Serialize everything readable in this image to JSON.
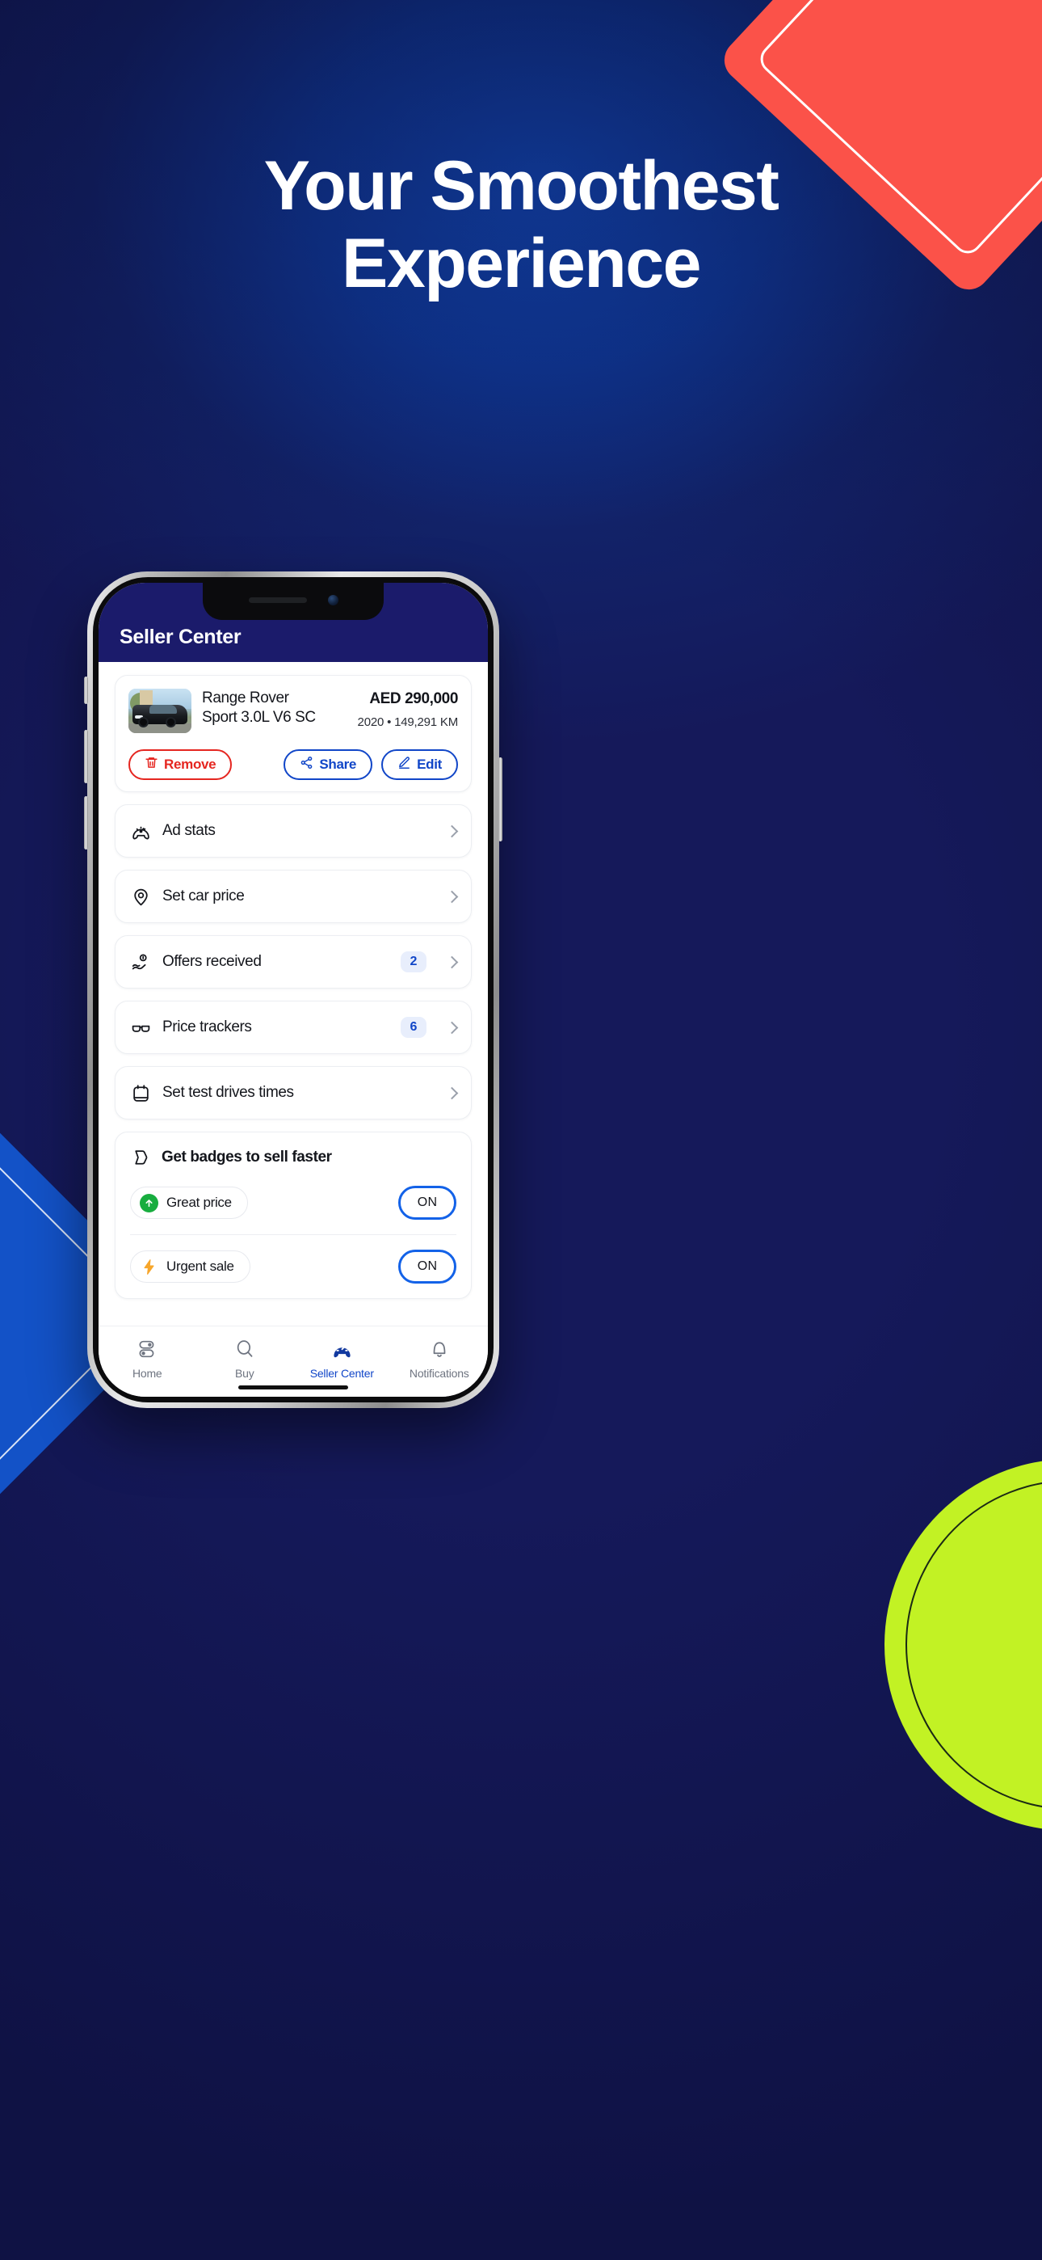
{
  "hero": {
    "headline_line1": "Your Smoothest",
    "headline_line2": "Experience"
  },
  "colors": {
    "brand_blue": "#1146c8",
    "header_navy": "#1b1b6b",
    "danger_red": "#e52620",
    "accent_red": "#fb5249",
    "accent_lime": "#c2f224",
    "badge_green": "#18ad3f",
    "badge_orange": "#f7a62b"
  },
  "app": {
    "header": {
      "title": "Seller Center"
    },
    "listing": {
      "title_line1": "Range Rover",
      "title_line2": "Sport 3.0L V6 SC",
      "price": "AED 290,000",
      "meta": "2020 • 149,291 KM",
      "thumb_icon": "car-photo",
      "actions": [
        {
          "label": "Remove",
          "icon": "trash-icon",
          "style": "red"
        },
        {
          "label": "Share",
          "icon": "share-icon",
          "style": "blue"
        },
        {
          "label": "Edit",
          "icon": "pencil-icon",
          "style": "blue"
        }
      ]
    },
    "menu": [
      {
        "label": "Ad stats",
        "icon": "gauge-icon",
        "badge": ""
      },
      {
        "label": "Set car price",
        "icon": "pin-tag-icon",
        "badge": ""
      },
      {
        "label": "Offers received",
        "icon": "hand-offer-icon",
        "badge": "2"
      },
      {
        "label": "Price trackers",
        "icon": "glasses-icon",
        "badge": "6"
      },
      {
        "label": "Set test drives times",
        "icon": "calendar-icon",
        "badge": ""
      }
    ],
    "badges_section": {
      "title": "Get badges to sell faster",
      "icon": "badge-tag-icon",
      "items": [
        {
          "label": "Great price",
          "icon": "arrow-up-circle-icon",
          "toggle": "ON"
        },
        {
          "label": "Urgent sale",
          "icon": "lightning-icon",
          "toggle": "ON"
        }
      ]
    },
    "tabs": [
      {
        "label": "Home",
        "icon": "toggles-icon",
        "active": false
      },
      {
        "label": "Buy",
        "icon": "search-icon",
        "active": false
      },
      {
        "label": "Seller Center",
        "icon": "gauge-filled-icon",
        "active": true
      },
      {
        "label": "Notifications",
        "icon": "bell-icon",
        "active": false
      }
    ]
  }
}
